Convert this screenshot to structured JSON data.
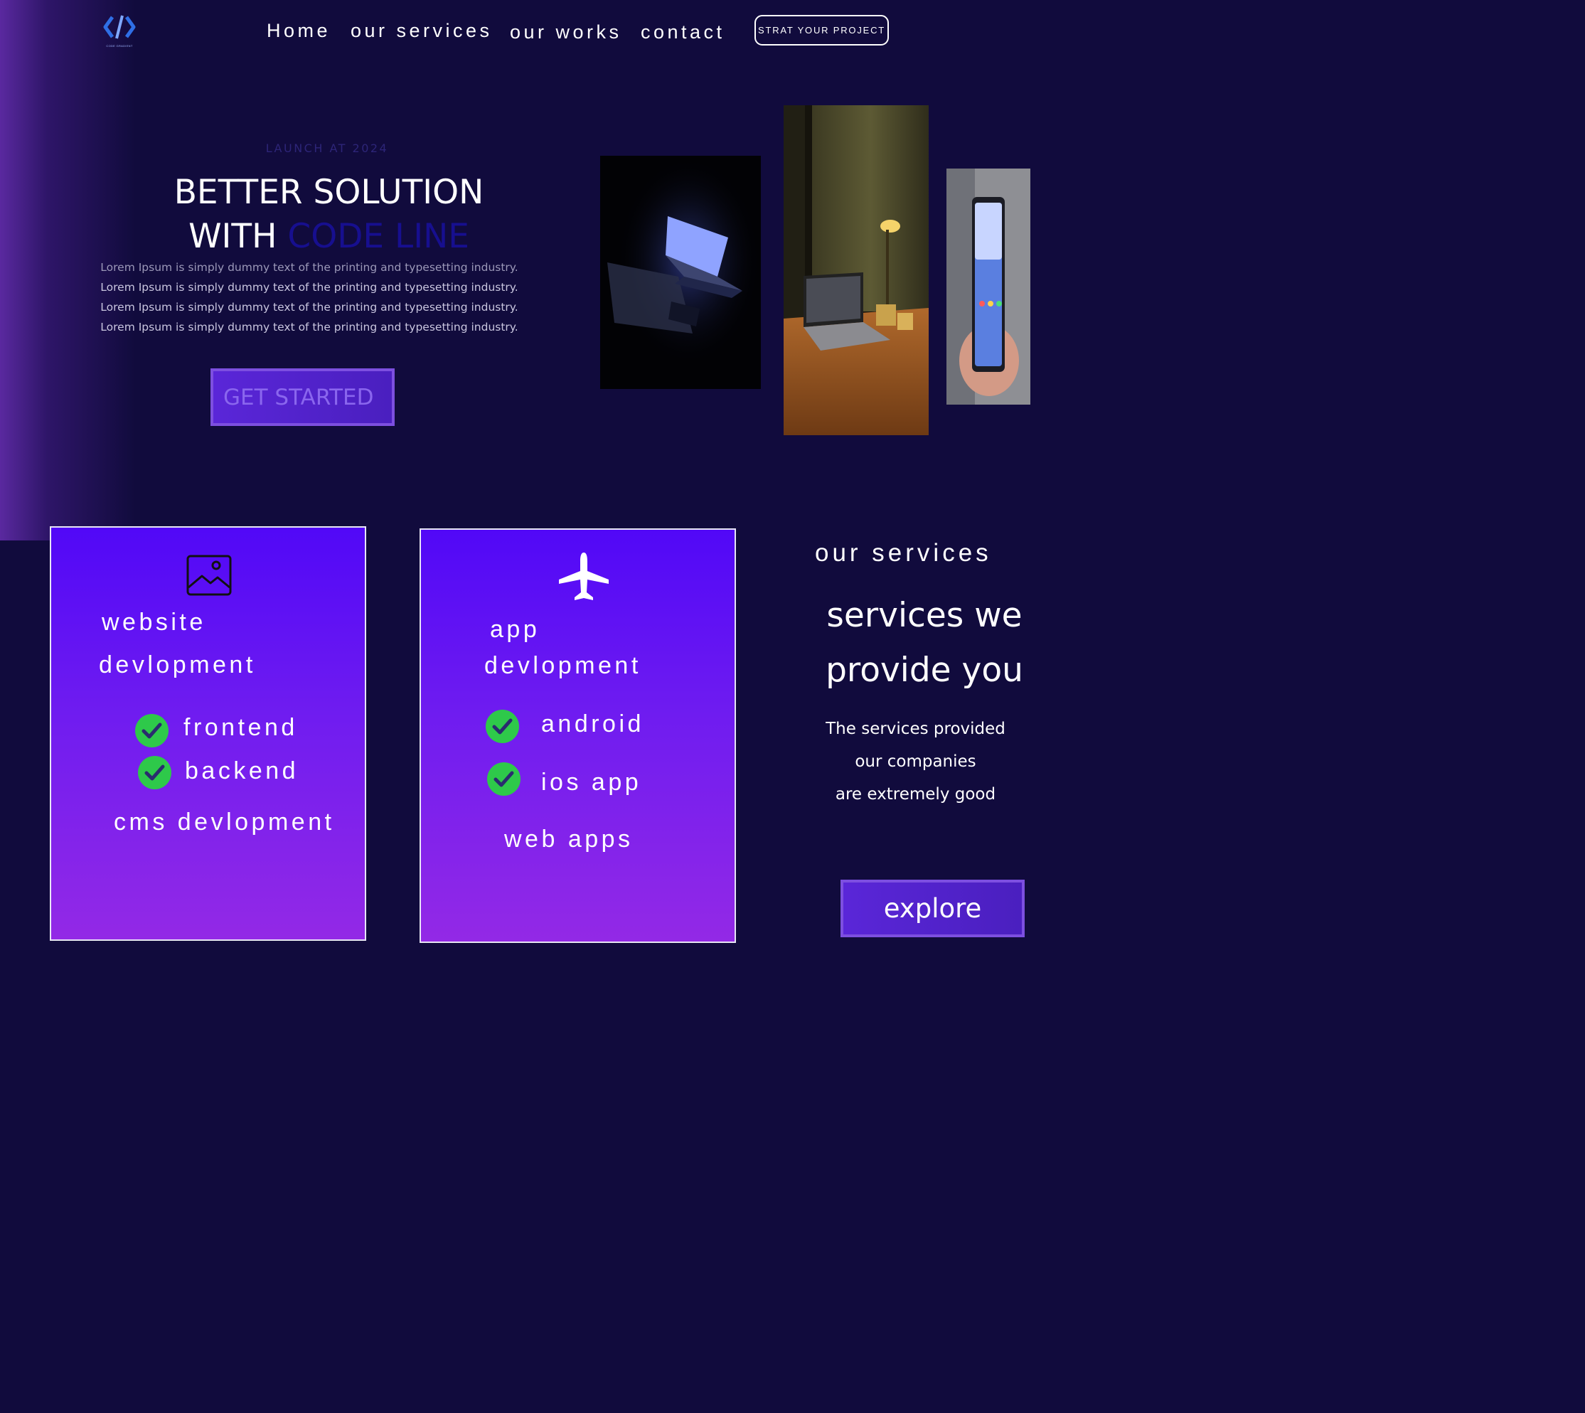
{
  "header": {
    "logo_caption": "CODE GRADIENT",
    "nav": [
      "Home",
      "our services",
      "our works",
      "contact"
    ],
    "cta_label": "STRAT YOUR PROJECT"
  },
  "hero": {
    "tag": "LAUNCH AT 2024",
    "title_line1": "BETTER SOLUTION",
    "title_line2_prefix": "WITH ",
    "title_line2_accent": "CODE LINE",
    "body_lines": [
      "Lorem Ipsum is simply dummy text of the printing and typesetting industry.",
      "Lorem Ipsum is simply dummy text of the printing and typesetting industry.",
      "Lorem Ipsum is simply dummy text of the printing and typesetting industry.",
      "Lorem Ipsum is simply dummy text of the printing and typesetting industry."
    ],
    "button_label": "GET STARTED"
  },
  "cards": [
    {
      "icon": "image-icon",
      "title_line1": "website",
      "title_line2": "devlopment",
      "items": [
        "frontend",
        "backend",
        "cms devlopment"
      ]
    },
    {
      "icon": "airplane-icon",
      "title_line1": "app",
      "title_line2": "devlopment",
      "items": [
        "android",
        "ios app",
        "web apps"
      ]
    }
  ],
  "services": {
    "eyebrow": "our services",
    "heading_line1": "services we",
    "heading_line2": "provide you",
    "body_lines": [
      "The services provided",
      "our companies",
      "are extremely good"
    ],
    "button_label": "explore"
  },
  "colors": {
    "background": "#110b3d",
    "accent_text": "#170f8f",
    "card_top": "#5108f7",
    "card_bottom": "#9329e6",
    "check_green": "#2ec94a",
    "button_border": "#7d4fe0"
  }
}
